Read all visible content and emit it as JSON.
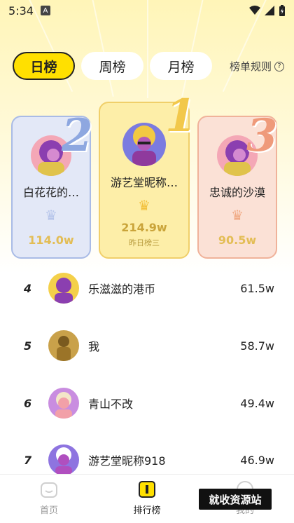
{
  "status_bar": {
    "time": "5:34",
    "notif_badge": "A"
  },
  "tabs": [
    {
      "label": "日榜",
      "active": true
    },
    {
      "label": "周榜",
      "active": false
    },
    {
      "label": "月榜",
      "active": false
    }
  ],
  "rules_label": "榜单规则",
  "podium": {
    "first": {
      "rank": "1",
      "name": "游艺堂昵称…",
      "score": "214.9w",
      "sub": "昨日榜三",
      "color": "#f2c84b"
    },
    "second": {
      "rank": "2",
      "name": "白花花的…",
      "score": "114.0w",
      "color": "#8ea7e0"
    },
    "third": {
      "rank": "3",
      "name": "忠诚的沙漠",
      "score": "90.5w",
      "color": "#ef9a7a"
    }
  },
  "list": [
    {
      "rank": "4",
      "name": "乐滋滋的港币",
      "score": "61.5w"
    },
    {
      "rank": "5",
      "name": "我",
      "score": "58.7w"
    },
    {
      "rank": "6",
      "name": "青山不改",
      "score": "49.4w"
    },
    {
      "rank": "7",
      "name": "游艺堂昵称918",
      "score": "46.9w"
    }
  ],
  "bottom_nav": [
    {
      "label": "首页",
      "icon": "home-icon",
      "active": false
    },
    {
      "label": "排行榜",
      "icon": "rank-icon",
      "active": true
    },
    {
      "label": "我的",
      "icon": "profile-icon",
      "active": false
    }
  ],
  "watermark": "就收资源站"
}
